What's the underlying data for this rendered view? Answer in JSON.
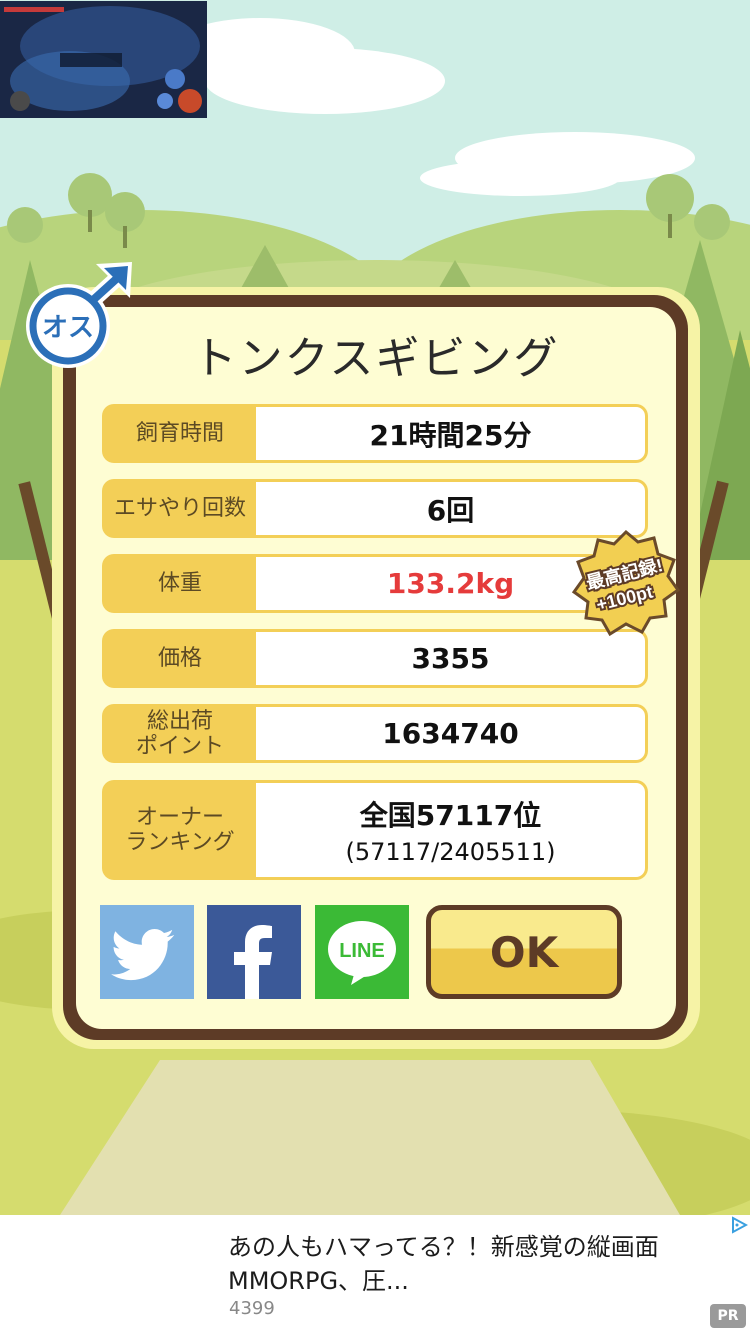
{
  "dialog": {
    "title": "トンクスギビング",
    "rows": [
      {
        "label": "飼育時間",
        "value": "21時間25分"
      },
      {
        "label": "エサやり回数",
        "value": "6回"
      },
      {
        "label": "体重",
        "value": "133.2kg"
      },
      {
        "label": "価格",
        "value": "3355"
      },
      {
        "label": "総出荷\nポイント",
        "value": "1634740"
      },
      {
        "label": "オーナー\nランキング",
        "value": "全国57117位",
        "sub_value": "(57117/2405511)"
      }
    ],
    "ok_label": "OK",
    "gender_badge": "オス",
    "record_badge_line1": "最高記録!",
    "record_badge_line2": "+100pt",
    "colors": {
      "weight_value": "#e53b3b",
      "frame": "#5d3b26",
      "label_bg": "#f3cf57"
    }
  },
  "social": {
    "twitter_icon": "twitter-bird-icon",
    "facebook_icon": "facebook-f-icon",
    "line_icon": "line-icon",
    "line_label": "LINE"
  },
  "ad": {
    "text": "あの人もハマってる？！新感覚の縦画面MMORPG、圧...",
    "source": "4399",
    "pr_label": "PR"
  }
}
